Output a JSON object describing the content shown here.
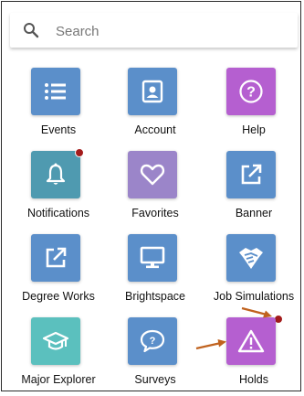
{
  "search": {
    "placeholder": "Search"
  },
  "tiles": [
    {
      "label": "Events",
      "icon": "list-icon",
      "color": "#5b8fca"
    },
    {
      "label": "Account",
      "icon": "contact-icon",
      "color": "#5b8fca"
    },
    {
      "label": "Help",
      "icon": "help-icon",
      "color": "#b55fd0"
    },
    {
      "label": "Notifications",
      "icon": "bell-icon",
      "color": "#4f9ab0"
    },
    {
      "label": "Favorites",
      "icon": "heart-icon",
      "color": "#9b85c9"
    },
    {
      "label": "Banner",
      "icon": "external-link-icon",
      "color": "#5b8fca"
    },
    {
      "label": "Degree Works",
      "icon": "external-link-icon",
      "color": "#5b8fca"
    },
    {
      "label": "Brightspace",
      "icon": "monitor-icon",
      "color": "#5b8fca"
    },
    {
      "label": "Job Simulations",
      "icon": "handshake-icon",
      "color": "#5b8fca"
    },
    {
      "label": "Major Explorer",
      "icon": "graduation-cap-icon",
      "color": "#5bc0be"
    },
    {
      "label": "Surveys",
      "icon": "question-bubble-icon",
      "color": "#5b8fca"
    },
    {
      "label": "Holds",
      "icon": "warning-icon",
      "color": "#b55fd0"
    }
  ],
  "colors": {
    "notification_dot": "#a31b1b",
    "annotation_arrow": "#c0621e"
  }
}
